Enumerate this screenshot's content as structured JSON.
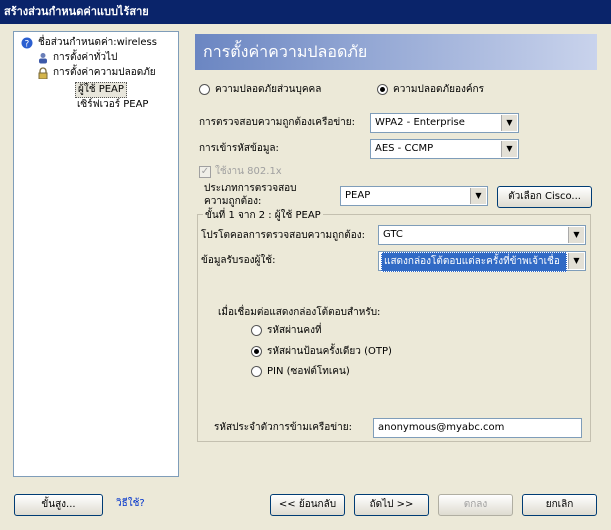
{
  "window": {
    "title": "สร้างส่วนกำหนดค่าแบบไร้สาย"
  },
  "tree": {
    "root": "ชื่อส่วนกำหนดค่า:wireless",
    "general": "การตั้งค่าทั่วไป",
    "security": "การตั้งค่าความปลอดภัย",
    "peap_user": "ผู้ใช้ PEAP",
    "peap_server": "เซิร์ฟเวอร์ PEAP"
  },
  "header": {
    "title": "การตั้งค่าความปลอดภัย"
  },
  "security_mode": {
    "personal": "ความปลอดภัยส่วนบุคคล",
    "enterprise": "ความปลอดภัยองค์กร",
    "selected": "enterprise"
  },
  "auth": {
    "label": "การตรวจสอบความถูกต้องเครือข่าย:",
    "value": "WPA2 - Enterprise"
  },
  "encryption": {
    "label": "การเข้ารหัสข้อมูล:",
    "value": "AES - CCMP"
  },
  "enable_8021x": {
    "label": "ใช้งาน 802.1x",
    "checked": true
  },
  "auth_type": {
    "label_line1": "ประเภทการตรวจสอบ",
    "label_line2": "ความถูกต้อง:",
    "value": "PEAP",
    "cisco_button": "ตัวเลือก Cisco..."
  },
  "step_group": {
    "title": "ขั้นที่ 1 จาก 2 : ผู้ใช้ PEAP"
  },
  "protocol": {
    "label": "โปรโตคอลการตรวจสอบความถูกต้อง:",
    "value": "GTC"
  },
  "credentials": {
    "label": "ข้อมูลรับรองผู้ใช้:",
    "value": "แสดงกล่องโต้ตอบแต่ละครั้งที่ข้าพเจ้าเชื่อ"
  },
  "prompt": {
    "label": "เมื่อเชื่อมต่อแสดงกล่องโต้ตอบสำหรับ:",
    "options": [
      "รหัสผ่านคงที่",
      "รหัสผ่านป้อนครั้งเดียว (OTP)",
      "PIN (ซอฟต์โทเคน)"
    ],
    "selected_index": 1
  },
  "roaming_id": {
    "label": "รหัสประจำตัวการข้ามเครือข่าย:",
    "value": "anonymous@myabc.com"
  },
  "footer": {
    "advanced": "ขั้นสูง...",
    "help": "วิธีใช้?",
    "back": "<< ย้อนกลับ",
    "next": "ถัดไป >>",
    "ok": "ตกลง",
    "cancel": "ยกเลิก"
  }
}
